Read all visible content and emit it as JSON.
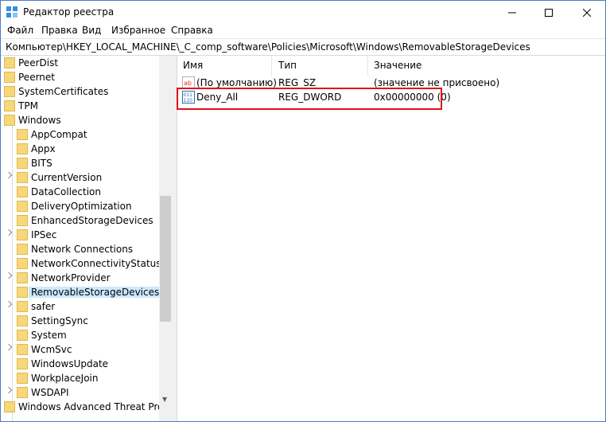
{
  "window": {
    "title": "Редактор реестра",
    "accent_color": "#4a7ec1",
    "controls": {
      "minimize": "minimize",
      "maximize": "maximize",
      "close": "close"
    }
  },
  "menu": [
    "Файл",
    "Правка",
    "Вид",
    "Избранное",
    "Справка"
  ],
  "address": "Компьютер\\HKEY_LOCAL_MACHINE\\_C_comp_software\\Policies\\Microsoft\\Windows\\RemovableStorageDevices",
  "tree": [
    {
      "label": "PeerDist",
      "level": 0,
      "expandable": false
    },
    {
      "label": "Peernet",
      "level": 0,
      "expandable": false
    },
    {
      "label": "SystemCertificates",
      "level": 0,
      "expandable": false
    },
    {
      "label": "TPM",
      "level": 0,
      "expandable": false
    },
    {
      "label": "Windows",
      "level": 0,
      "expandable": false
    },
    {
      "label": "AppCompat",
      "level": 1,
      "expandable": false
    },
    {
      "label": "Appx",
      "level": 1,
      "expandable": false
    },
    {
      "label": "BITS",
      "level": 1,
      "expandable": false
    },
    {
      "label": "CurrentVersion",
      "level": 1,
      "expandable": true
    },
    {
      "label": "DataCollection",
      "level": 1,
      "expandable": false
    },
    {
      "label": "DeliveryOptimization",
      "level": 1,
      "expandable": false
    },
    {
      "label": "EnhancedStorageDevices",
      "level": 1,
      "expandable": false
    },
    {
      "label": "IPSec",
      "level": 1,
      "expandable": true
    },
    {
      "label": "Network Connections",
      "level": 1,
      "expandable": false
    },
    {
      "label": "NetworkConnectivityStatusInd",
      "level": 1,
      "expandable": false
    },
    {
      "label": "NetworkProvider",
      "level": 1,
      "expandable": true
    },
    {
      "label": "RemovableStorageDevices",
      "level": 1,
      "expandable": false,
      "selected": true
    },
    {
      "label": "safer",
      "level": 1,
      "expandable": true
    },
    {
      "label": "SettingSync",
      "level": 1,
      "expandable": false
    },
    {
      "label": "System",
      "level": 1,
      "expandable": false
    },
    {
      "label": "WcmSvc",
      "level": 1,
      "expandable": true
    },
    {
      "label": "WindowsUpdate",
      "level": 1,
      "expandable": false
    },
    {
      "label": "WorkplaceJoin",
      "level": 1,
      "expandable": false
    },
    {
      "label": "WSDAPI",
      "level": 1,
      "expandable": true
    },
    {
      "label": "Windows Advanced Threat Protec",
      "level": 0,
      "expandable": false
    }
  ],
  "columns": {
    "name": "Имя",
    "type": "Тип",
    "value": "Значение"
  },
  "values": [
    {
      "icon": "string-value-icon",
      "name": "(По умолчанию)",
      "type": "REG_SZ",
      "data": "(значение не присвоено)"
    },
    {
      "icon": "dword-value-icon",
      "name": "Deny_All",
      "type": "REG_DWORD",
      "data": "0x00000000 (0)"
    }
  ],
  "colors": {
    "selection": "#cce8ff",
    "highlight_box": "#e0121a",
    "folder": "#f6d77a"
  }
}
